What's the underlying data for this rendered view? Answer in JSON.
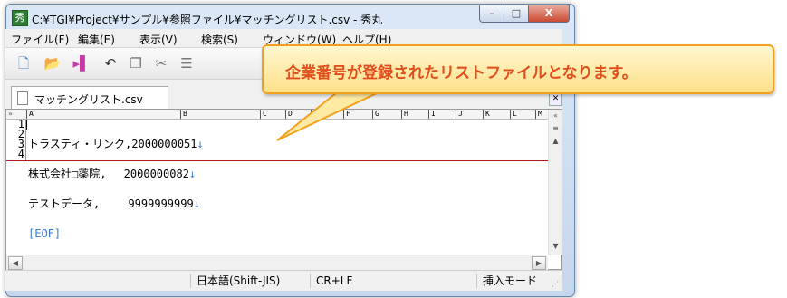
{
  "window": {
    "title": "C:¥TGI¥Project¥サンプル¥参照ファイル¥マッチングリスト.csv - 秀丸",
    "minimize": "–",
    "maximize": "□",
    "close": "X",
    "app_icon": "秀"
  },
  "menu": [
    "ファイル(F)",
    "編集(E)",
    "表示(V)",
    "検索(S)",
    "ウィンドウ(W)",
    "ヘルプ(H)"
  ],
  "toolbar": {
    "icons": [
      "new-file-icon",
      "open-folder-icon",
      "save-icon",
      "undo-icon",
      "copy-icon",
      "cut-icon",
      "paste-icon"
    ]
  },
  "tab": {
    "label": "マッチングリスト.csv",
    "close": "✕"
  },
  "ruler": {
    "left": "»",
    "columns": [
      "A",
      "B",
      "C",
      "D",
      "E",
      "F",
      "G",
      "H",
      "I",
      "J",
      "K",
      "L",
      "M"
    ],
    "right": "«"
  },
  "editor": {
    "line_numbers": [
      "1",
      "2",
      "3",
      "4"
    ],
    "lines": [
      {
        "text": "トラスティ・リンク,2000000051",
        "eol": "↓"
      },
      {
        "text": "株式会社□薬院,　 2000000082",
        "eol": "↓"
      },
      {
        "text": "テストデータ,　　 9999999999",
        "eol": "↓"
      },
      {
        "text": "",
        "eol": "[EOF]"
      }
    ]
  },
  "statusbar": {
    "encoding": "日本語(Shift-JIS)",
    "newline": "CR+LF",
    "mode": "挿入モード"
  },
  "callout": {
    "text": "企業番号が登録されたリストファイルとなります。"
  },
  "colors": {
    "callout_border": "#f2a11f",
    "callout_text": "#e14f1c",
    "eof_line": "#b01818",
    "marker": "#3a7bd5"
  }
}
